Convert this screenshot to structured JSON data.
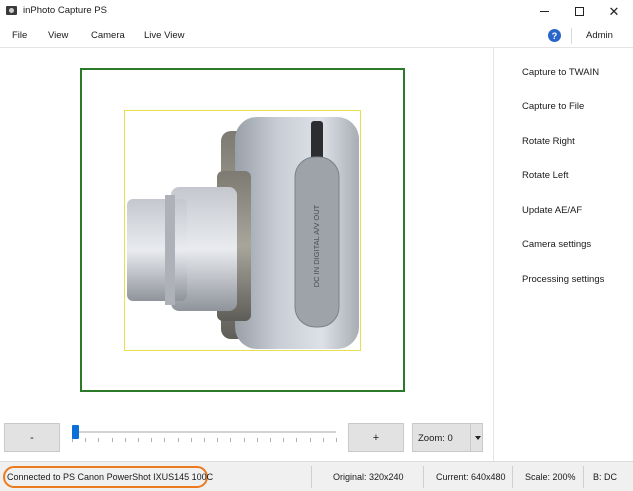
{
  "window": {
    "title": "inPhoto Capture PS"
  },
  "menu": {
    "items": [
      "File",
      "View",
      "Camera",
      "Live View"
    ],
    "help": "?",
    "admin": "Admin"
  },
  "preview": {
    "subject": "silver compact digital camera, side view",
    "lens_text": "DC IN DIGITAL A/V OUT"
  },
  "actions": [
    "Capture to TWAIN",
    "Capture to File",
    "Rotate Right",
    "Rotate Left",
    "Update AE/AF",
    "Camera settings",
    "Processing settings"
  ],
  "zoom_controls": {
    "minus": "-",
    "plus": "+",
    "zoom_label": "Zoom: 0",
    "slider_level": 0
  },
  "status": {
    "connection": "Connected to PS Canon PowerShot IXUS145 100C",
    "original": "Original: 320x240",
    "current": "Current: 640x480",
    "scale": "Scale: 200%",
    "mode": "B: DC"
  },
  "colors": {
    "preview_border": "#2a7a2a",
    "photo_border": "#e8e04a",
    "slider_accent": "#0a6fd6",
    "status_highlight": "#ec7a1e",
    "help_icon": "#2a66c9"
  }
}
